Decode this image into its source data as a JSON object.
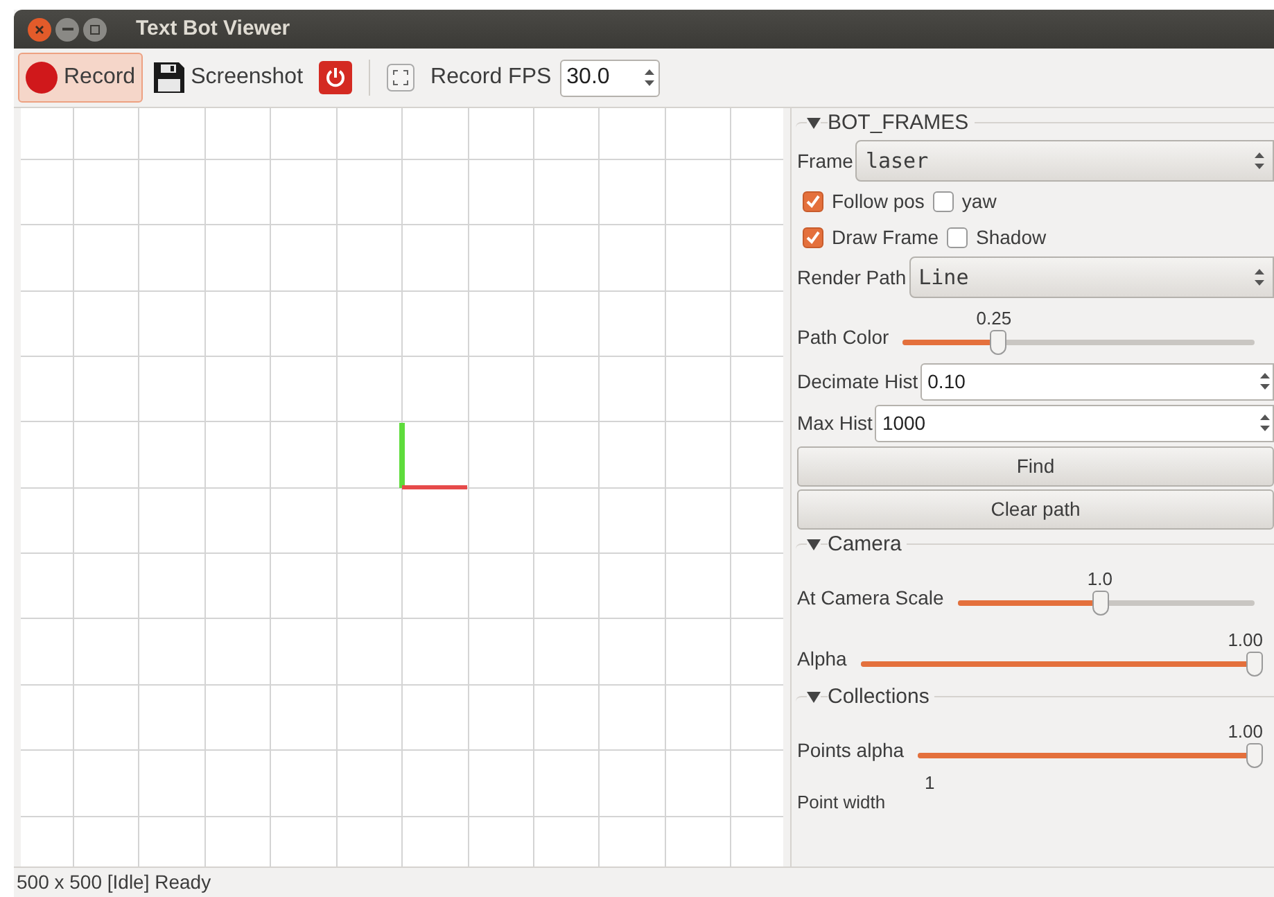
{
  "window": {
    "title": "Text Bot Viewer"
  },
  "toolbar": {
    "record": {
      "label": "Record",
      "selected": true
    },
    "screenshot": {
      "label": "Screenshot"
    },
    "fps_label": "Record FPS",
    "fps_value": "30.0"
  },
  "sections": [
    {
      "title": "BOT_FRAMES",
      "expanded": true,
      "items": [
        {
          "kind": "select",
          "label": "Frame",
          "value": "laser"
        },
        {
          "kind": "checks",
          "checks": [
            {
              "label": "Follow pos",
              "checked": true
            },
            {
              "label": "yaw",
              "checked": false
            }
          ]
        },
        {
          "kind": "checks",
          "checks": [
            {
              "label": "Draw Frame",
              "checked": true
            },
            {
              "label": "Shadow",
              "checked": false
            }
          ]
        },
        {
          "kind": "select",
          "label": "Render Path",
          "value": "Line"
        },
        {
          "kind": "slider",
          "label": "Path Color",
          "value": "0.25",
          "level": 0.27
        },
        {
          "kind": "spin",
          "label": "Decimate Hist",
          "value": "0.10"
        },
        {
          "kind": "spin",
          "label": "Max Hist",
          "value": "1000"
        },
        {
          "kind": "button",
          "label": "Find"
        },
        {
          "kind": "button",
          "label": "Clear path"
        }
      ]
    },
    {
      "title": "Camera",
      "expanded": true,
      "items": [
        {
          "kind": "slider",
          "label": "At Camera Scale",
          "value": "1.0",
          "level": 0.48
        },
        {
          "kind": "slider",
          "label": "Alpha",
          "value": "1.00",
          "level": 1
        }
      ]
    },
    {
      "title": "Collections",
      "expanded": true,
      "items": [
        {
          "kind": "slider",
          "label": "Points alpha",
          "value": "1.00",
          "level": 1
        },
        {
          "kind": "caption",
          "label": "Point width",
          "value": "1"
        }
      ]
    }
  ],
  "status_bar": "500 x 500 [Idle] Ready"
}
